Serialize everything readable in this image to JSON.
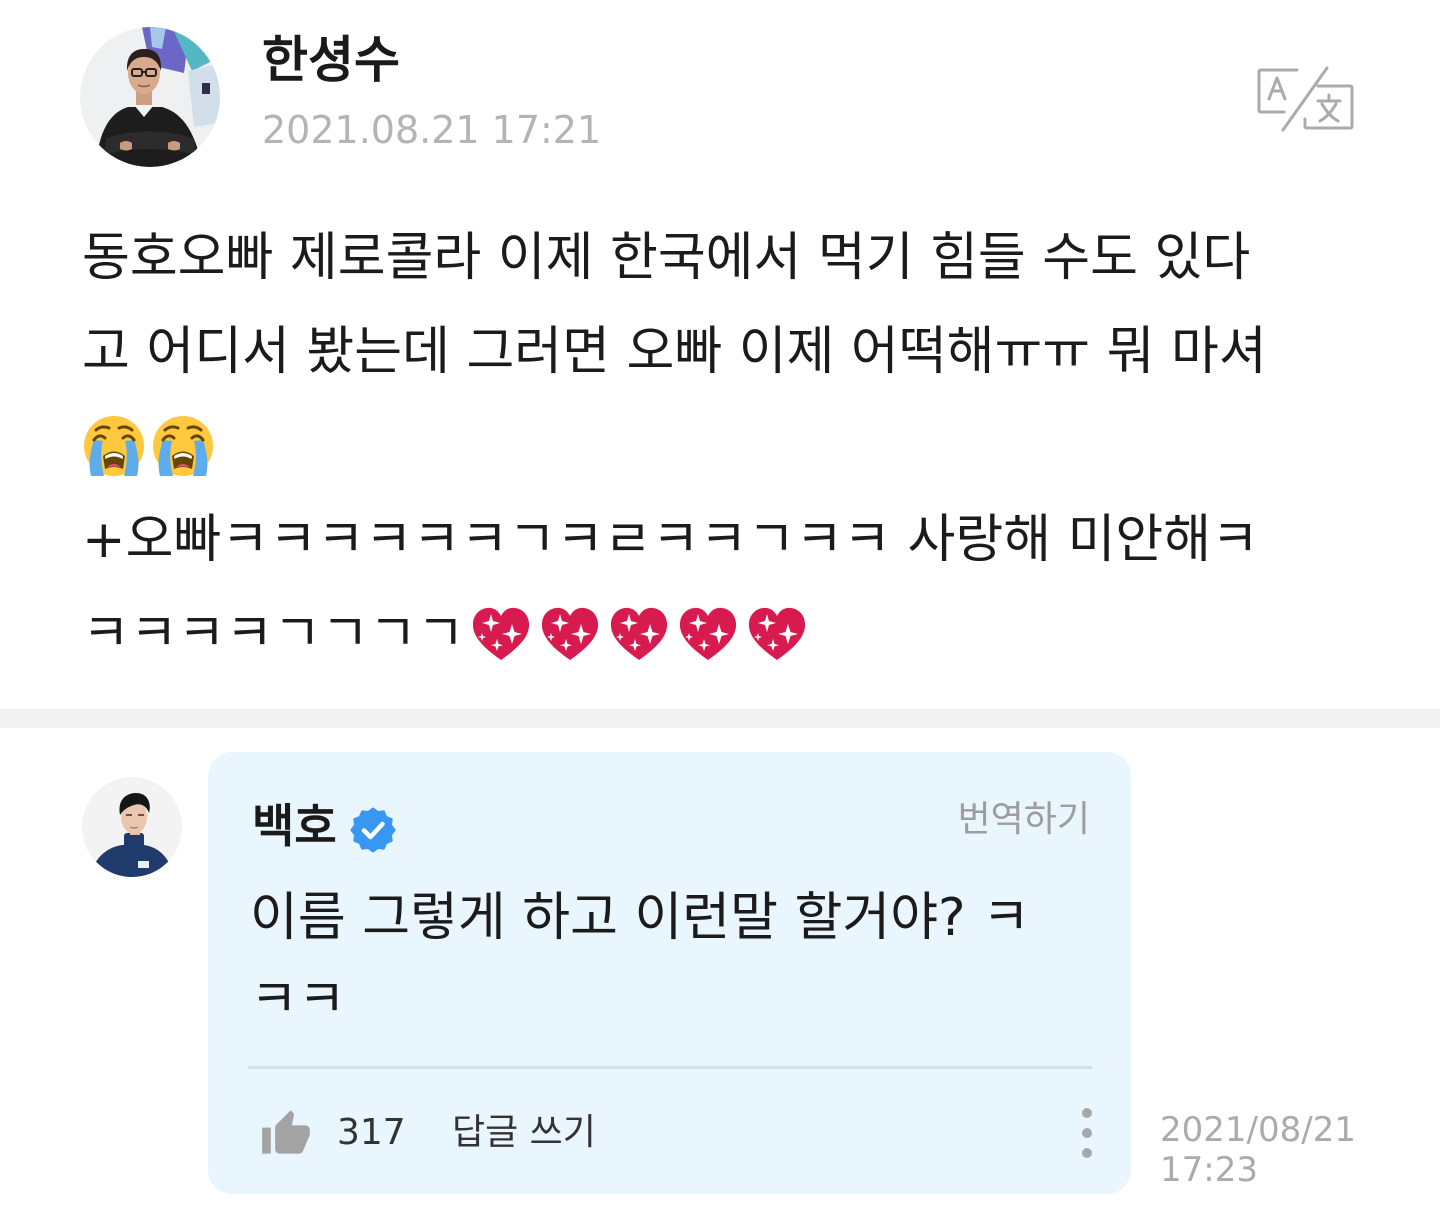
{
  "post": {
    "author": "한셩수",
    "date": "2021.08.21 17:21",
    "lines": [
      "동호오빠 제로콜라 이제 한국에서 먹기 힘들 수도 있다",
      "고 어디서 봤는데 그러면 오빠 이제 어떡해ㅠㅠ 뭐 마셔",
      "+오빠ㅋㅋㅋㅋㅋㅋㄱㅋㄹㅋㅋㄱㅋㅋ 사랑해 미안해ㅋ",
      "ㅋㅋㅋㅋㄱㄱㄱㄱ"
    ],
    "emoji_line": [
      "loudly-crying-face",
      "loudly-crying-face"
    ],
    "trailing_emojis": [
      "sparkling-heart",
      "sparkling-heart",
      "sparkling-heart",
      "sparkling-heart",
      "sparkling-heart"
    ]
  },
  "comment": {
    "author": "백호",
    "translate_label": "번역하기",
    "lines": [
      "이름 그렇게 하고 이런말 할거야? ㅋ",
      "ㅋㅋ"
    ],
    "likes": "317",
    "reply_label": "답글 쓰기",
    "date": "2021/08/21",
    "time": "17:23"
  },
  "icons": {
    "translate": "translate-icon",
    "verified": "verified-badge-icon",
    "like": "thumbs-up-icon",
    "more": "more-vertical-icon"
  },
  "colors": {
    "bubble_bg": "#e9f6fd",
    "verified_blue": "#3897f0",
    "separator": "#f2f3f5",
    "muted_text": "#b4b4b4"
  }
}
